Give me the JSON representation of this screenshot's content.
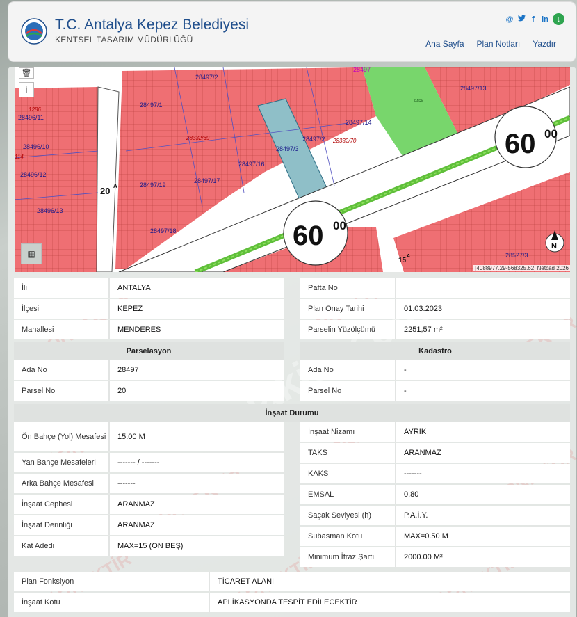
{
  "header": {
    "title": "T.C. Antalya Kepez Belediyesi",
    "subtitle": "KENTSEL TASARIM MÜDÜRLÜĞÜ",
    "nav": [
      "Ana Sayfa",
      "Plan Notları",
      "Yazdır"
    ],
    "socials": [
      "@",
      "t",
      "f",
      "in",
      "↓"
    ]
  },
  "map": {
    "coord_text": "[4088977.29-568325.62] Netcad 2026",
    "road_label": "60",
    "road_label_sup": "00",
    "side_road": "20",
    "side_road_sup": "A",
    "side_road2": "15",
    "side_road2_sup": "A",
    "parcel_labels": [
      "28497/2",
      "28497/1",
      "28496/11",
      "28496/10",
      "28496/12",
      "28496/13",
      "28497/19",
      "28497/17",
      "28497/16",
      "28497/3",
      "28497/2",
      "28497/14",
      "28497/13",
      "28497/18",
      "28527/3",
      "28332/69",
      "28332/70",
      "1286",
      "28497",
      "114"
    ],
    "park_label": "PARK",
    "north_label": "N"
  },
  "top_left": [
    {
      "label": "İli",
      "value": "ANTALYA"
    },
    {
      "label": "İlçesi",
      "value": "KEPEZ"
    },
    {
      "label": "Mahallesi",
      "value": "MENDERES"
    }
  ],
  "top_right": [
    {
      "label": "Pafta No",
      "value": ""
    },
    {
      "label": "Plan Onay Tarihi",
      "value": "01.03.2023"
    },
    {
      "label": "Parselin Yüzölçümü",
      "value": "2251,57 m²"
    }
  ],
  "sections": {
    "parselasyon": "Parselasyon",
    "kadastro": "Kadastro",
    "insaat": "İnşaat Durumu"
  },
  "parselasyon": [
    {
      "label": "Ada No",
      "value": "28497"
    },
    {
      "label": "Parsel No",
      "value": "20"
    }
  ],
  "kadastro": [
    {
      "label": "Ada No",
      "value": "-"
    },
    {
      "label": "Parsel No",
      "value": "-"
    }
  ],
  "insaat_left": [
    {
      "label": "Ön Bahçe (Yol) Mesafesi",
      "value": "15.00 M"
    },
    {
      "label": "Yan Bahçe Mesafeleri",
      "value": "------- / -------"
    },
    {
      "label": "Arka Bahçe Mesafesi",
      "value": "-------"
    },
    {
      "label": "İnşaat Cephesi",
      "value": "ARANMAZ"
    },
    {
      "label": "İnşaat Derinliği",
      "value": "ARANMAZ"
    },
    {
      "label": "Kat Adedi",
      "value": "MAX=15 (ON BEŞ)"
    }
  ],
  "insaat_right": [
    {
      "label": "İnşaat Nizamı",
      "value": "AYRIK"
    },
    {
      "label": "TAKS",
      "value": "ARANMAZ"
    },
    {
      "label": "KAKS",
      "value": "-------"
    },
    {
      "label": "EMSAL",
      "value": "0.80"
    },
    {
      "label": "Saçak Seviyesi (h)",
      "value": "P.A.İ.Y."
    },
    {
      "label": "Subasman Kotu",
      "value": "MAX=0.50 M"
    },
    {
      "label": "Minimum İfraz Şartı",
      "value": "2000.00 M²"
    }
  ],
  "bottom": [
    {
      "label": "Plan Fonksiyon",
      "value": "TİCARET ALANI"
    },
    {
      "label": "İnşaat Kotu",
      "value": "APLİKASYONDA TESPİT EDİLECEKTİR"
    }
  ],
  "watermarks": [
    "ÖRNEKTİR",
    "emlakjet.com"
  ]
}
